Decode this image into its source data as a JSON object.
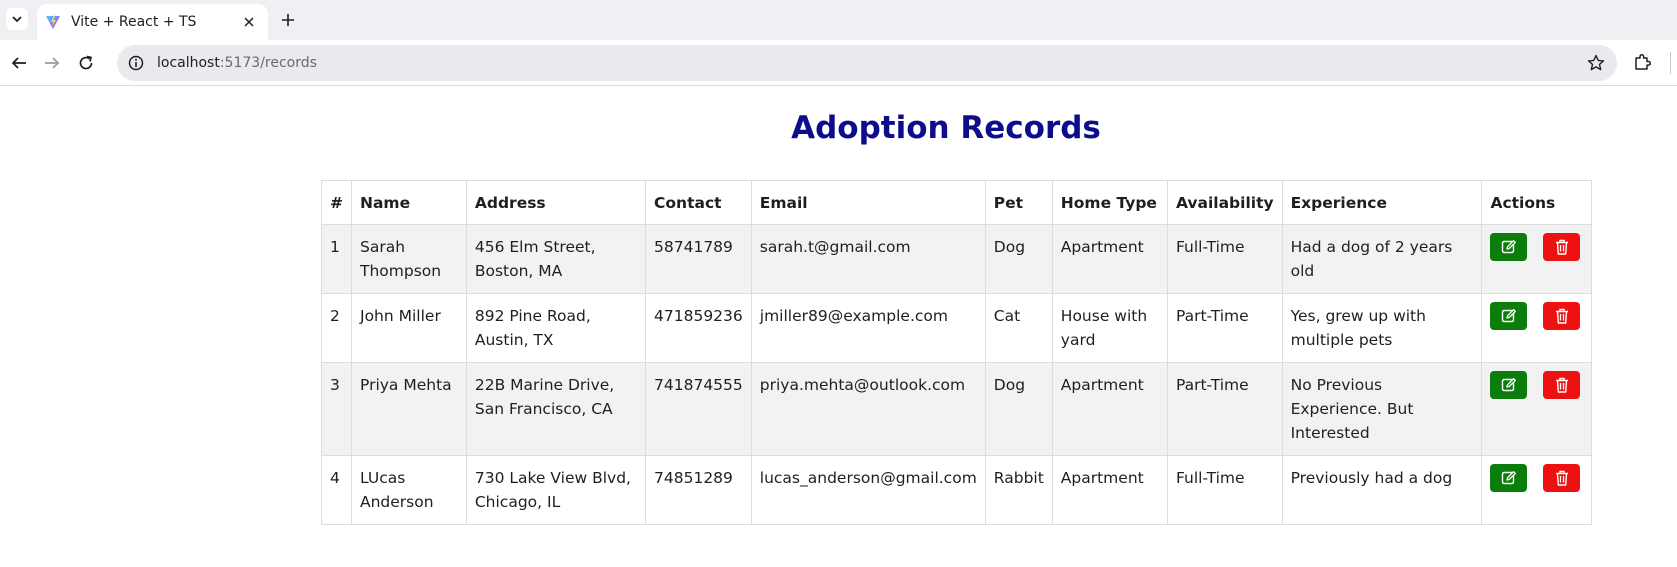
{
  "browser": {
    "tab_title": "Vite + React + TS",
    "url_host": "localhost",
    "url_path": ":5173/records"
  },
  "page": {
    "title": "Adoption Records"
  },
  "table": {
    "headers": [
      "#",
      "Name",
      "Address",
      "Contact",
      "Email",
      "Pet",
      "Home Type",
      "Availability",
      "Experience",
      "Actions"
    ],
    "rows": [
      {
        "num": "1",
        "name": "Sarah Thompson",
        "address": "456 Elm Street, Boston, MA",
        "contact": "58741789",
        "email": "sarah.t@gmail.com",
        "pet": "Dog",
        "home_type": "Apartment",
        "availability": "Full-Time",
        "experience": "Had a dog of 2 years old"
      },
      {
        "num": "2",
        "name": "John Miller",
        "address": "892 Pine Road, Austin, TX",
        "contact": "471859236",
        "email": "jmiller89@example.com",
        "pet": "Cat",
        "home_type": "House with yard",
        "availability": "Part-Time",
        "experience": "Yes, grew up with multiple pets"
      },
      {
        "num": "3",
        "name": "Priya Mehta",
        "address": "22B Marine Drive, San Francisco, CA",
        "contact": "741874555",
        "email": "priya.mehta@outlook.com",
        "pet": "Dog",
        "home_type": "Apartment",
        "availability": "Part-Time",
        "experience": "No Previous Experience. But Interested"
      },
      {
        "num": "4",
        "name": "LUcas Anderson",
        "address": "730 Lake View Blvd, Chicago, IL",
        "contact": "74851289",
        "email": "lucas_anderson@gmail.com",
        "pet": "Rabbit",
        "home_type": "Apartment",
        "availability": "Full-Time",
        "experience": "Previously had a dog"
      }
    ]
  },
  "icons": {
    "edit": "edit-icon",
    "delete": "trash-icon"
  },
  "colors": {
    "title": "#0d0d8c",
    "edit_button": "#0b7d0b",
    "delete_button": "#ee1111",
    "row_stripe": "#f2f2f2"
  }
}
